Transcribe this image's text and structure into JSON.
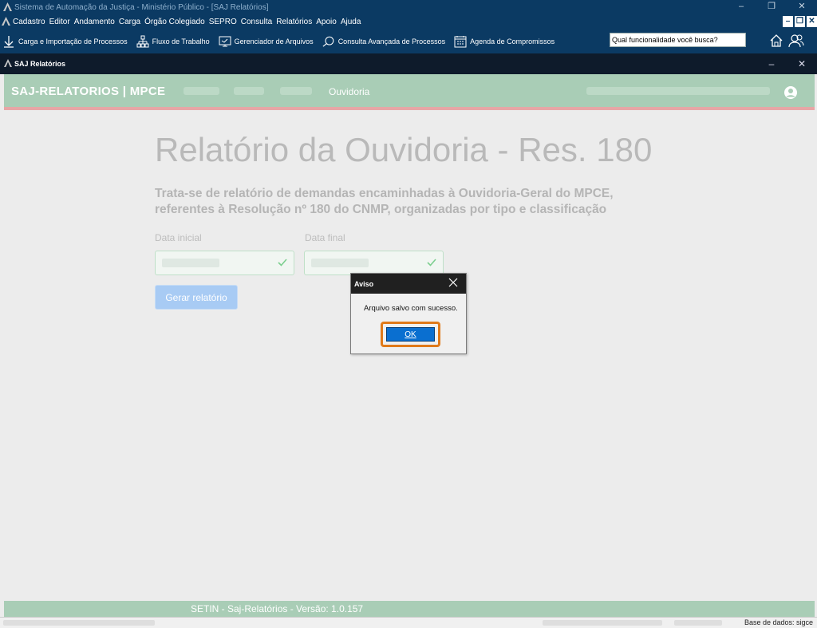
{
  "window": {
    "title": "Sistema de Automação da Justiça - Ministério Público - [SAJ Relatórios]",
    "min": "–",
    "restore": "❐",
    "close": "✕"
  },
  "menubar": {
    "items": [
      "Cadastro",
      "Editor",
      "Andamento",
      "Carga",
      "Órgão Colegiado",
      "SEPRO",
      "Consulta",
      "Relatórios",
      "Apoio",
      "Ajuda"
    ],
    "mdi_min": "–",
    "mdi_restore": "❐",
    "mdi_close": "✕"
  },
  "toolbar": {
    "items": [
      {
        "label": "Carga e Importação de Processos",
        "icon": "download-arrow-icon"
      },
      {
        "label": "Fluxo de Trabalho",
        "icon": "workflow-icon"
      },
      {
        "label": "Gerenciador de Arquivos",
        "icon": "file-manager-icon"
      },
      {
        "label": "Consulta Avançada de Processos",
        "icon": "search-icon"
      },
      {
        "label": "Agenda de Compromissos",
        "icon": "calendar-icon"
      }
    ],
    "search_placeholder": "Qual funcionalidade você busca?"
  },
  "subwindow": {
    "title": "SAJ Relatórios",
    "min": "–",
    "close": "✕"
  },
  "app": {
    "brand": "SAJ-RELATORIOS | MPCE",
    "nav_active": "Ouvidoria",
    "page_title": "Relatório da Ouvidoria - Res. 180",
    "subtitle": "Trata-se de relatório de demandas encaminhadas à Ouvidoria-Geral do MPCE, referentes à Resolução nº 180 do CNMP, organizadas por tipo e classificação",
    "date_start_label": "Data inicial",
    "date_end_label": "Data final",
    "generate_button": "Gerar relatório",
    "footer": "SETIN - Saj-Relatórios - Versão: 1.0.157"
  },
  "statusbar": {
    "database": "Base de dados: sigce"
  },
  "dialog": {
    "title": "Aviso",
    "message": "Arquivo salvo com sucesso.",
    "ok": "OK"
  },
  "colors": {
    "os_bar": "#0b3a63",
    "app_header": "#a9cdb6",
    "accent_line": "#e7a6a6",
    "primary_button": "#a8cbf4",
    "ok_focus_ring": "#e07a1a",
    "ok_button": "#0a6fd0"
  }
}
